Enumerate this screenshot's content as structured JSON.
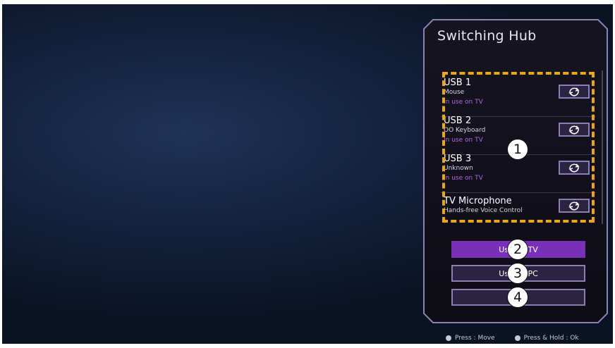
{
  "panel": {
    "title": "Switching Hub"
  },
  "devices": [
    {
      "name": "USB 1",
      "description": "Mouse",
      "status": "In use on TV"
    },
    {
      "name": "USB 2",
      "description": "OO Keyboard",
      "status": "In use on TV"
    },
    {
      "name": "USB 3",
      "description": "Unknown",
      "status": "In use on TV"
    },
    {
      "name": "TV Microphone",
      "description": "Hands-free Voice Control",
      "status": ""
    }
  ],
  "buttons": {
    "use_on_tv": "Use on TV",
    "use_on_pc": "Use on PC",
    "third": ""
  },
  "callouts": {
    "one": "1",
    "two": "2",
    "three": "3",
    "four": "4"
  },
  "hints": {
    "move": "Press : Move",
    "hold": "Press & Hold : Ok"
  },
  "colors": {
    "accent": "#7a2fb8",
    "status_text": "#b067e6",
    "highlight_dash": "#e8a618"
  },
  "icons": {
    "swap": "swap-icon",
    "hint_dot": "button-dot-icon"
  }
}
